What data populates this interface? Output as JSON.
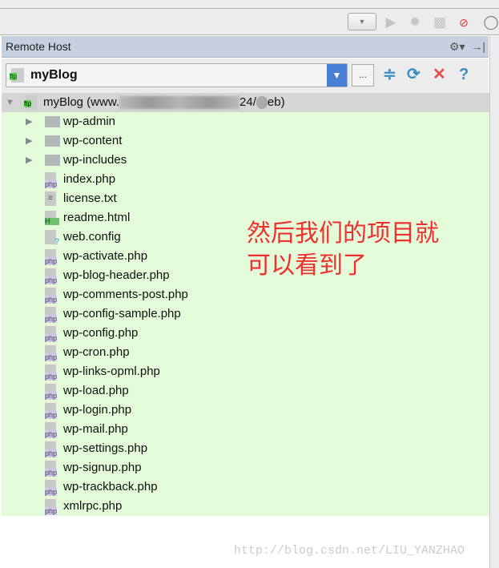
{
  "panel": {
    "title": "Remote Host"
  },
  "combo": {
    "selected": "myBlog",
    "more_label": "..."
  },
  "root": {
    "label_start": "myBlog (www.",
    "label_mid": "24/",
    "label_end": "eb)"
  },
  "items": [
    {
      "name": "wp-admin",
      "type": "folder"
    },
    {
      "name": "wp-content",
      "type": "folder"
    },
    {
      "name": "wp-includes",
      "type": "folder"
    },
    {
      "name": "index.php",
      "type": "php"
    },
    {
      "name": "license.txt",
      "type": "txt"
    },
    {
      "name": "readme.html",
      "type": "html"
    },
    {
      "name": "web.config",
      "type": "unknown"
    },
    {
      "name": "wp-activate.php",
      "type": "php"
    },
    {
      "name": "wp-blog-header.php",
      "type": "php"
    },
    {
      "name": "wp-comments-post.php",
      "type": "php"
    },
    {
      "name": "wp-config-sample.php",
      "type": "php"
    },
    {
      "name": "wp-config.php",
      "type": "php"
    },
    {
      "name": "wp-cron.php",
      "type": "php"
    },
    {
      "name": "wp-links-opml.php",
      "type": "php"
    },
    {
      "name": "wp-load.php",
      "type": "php"
    },
    {
      "name": "wp-login.php",
      "type": "php"
    },
    {
      "name": "wp-mail.php",
      "type": "php"
    },
    {
      "name": "wp-settings.php",
      "type": "php"
    },
    {
      "name": "wp-signup.php",
      "type": "php"
    },
    {
      "name": "wp-trackback.php",
      "type": "php"
    },
    {
      "name": "xmlrpc.php",
      "type": "php"
    }
  ],
  "annotation": {
    "line1": "然后我们的项目就",
    "line2": "可以看到了"
  },
  "watermark": "http://blog.csdn.net/LIU_YANZHAO",
  "icons": {
    "ftp_label": "ftp",
    "php_label": "php",
    "html_label": "H"
  }
}
